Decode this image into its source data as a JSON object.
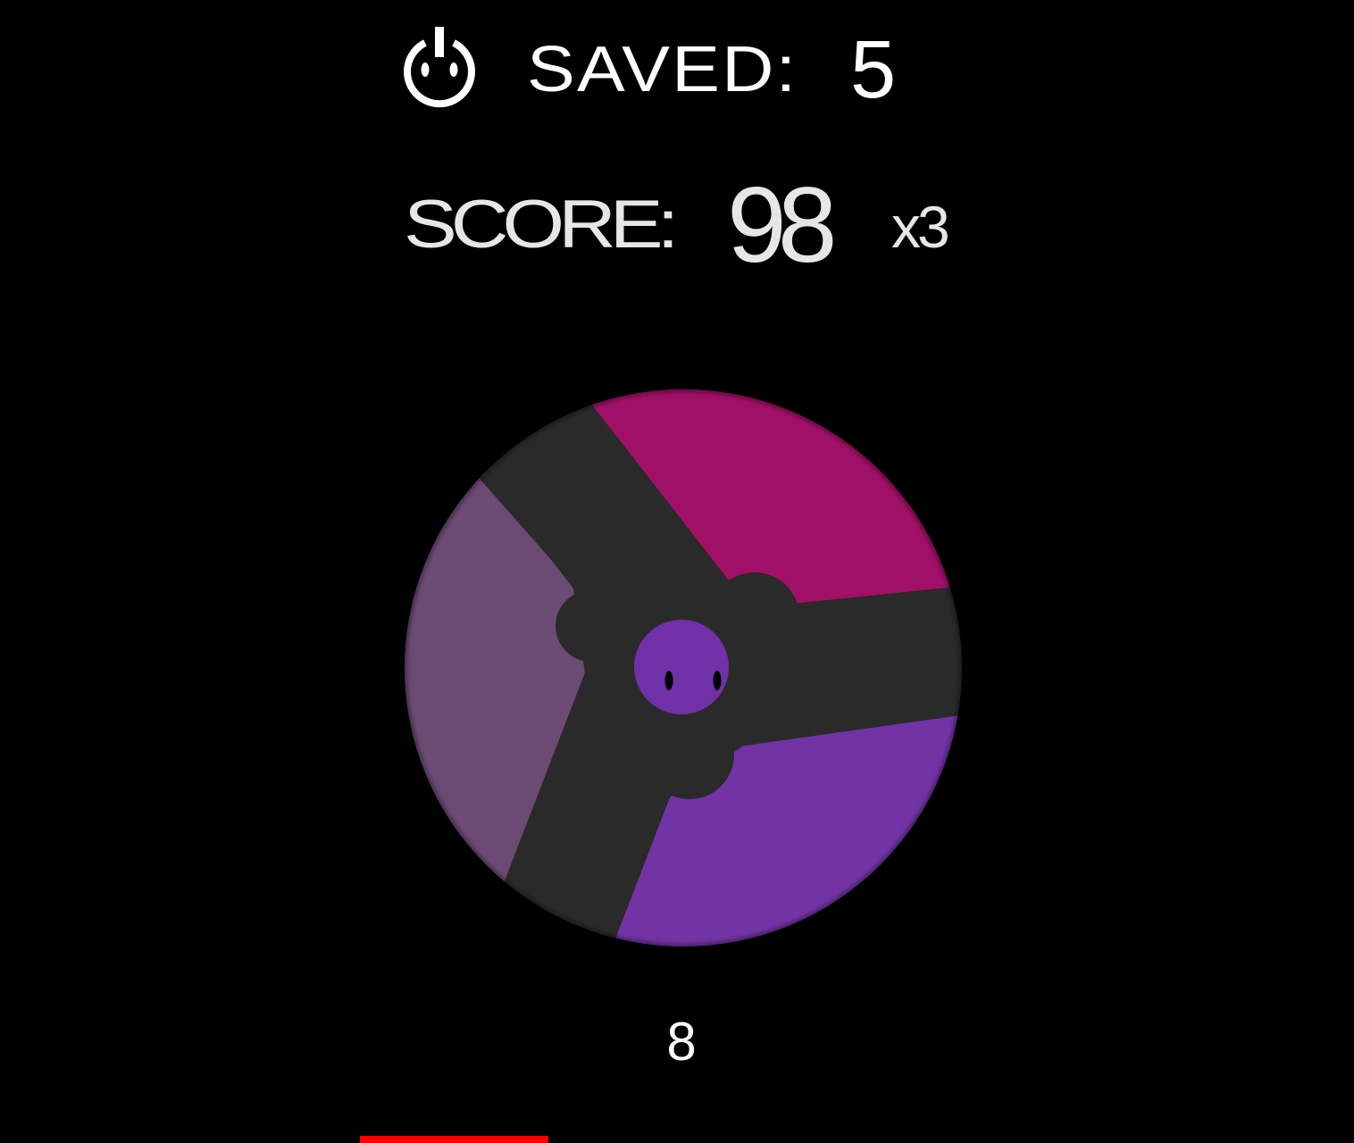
{
  "hud": {
    "saved_label": "SAVED:",
    "saved_value": "5",
    "score_label": "SCORE:",
    "score_value": "98",
    "multiplier": "x3"
  },
  "counter": "8",
  "icons": {
    "power": "power-icon"
  },
  "wheel": {
    "segments": [
      {
        "name": "magenta-segment",
        "color": "#a01066"
      },
      {
        "name": "mauve-segment",
        "color": "#6b4a74"
      },
      {
        "name": "purple-segment",
        "color": "#7234a4"
      }
    ],
    "spoke_color": "#2a2a2a",
    "ball_color": "#7030a8"
  },
  "progress": {
    "color": "#ff0000"
  }
}
